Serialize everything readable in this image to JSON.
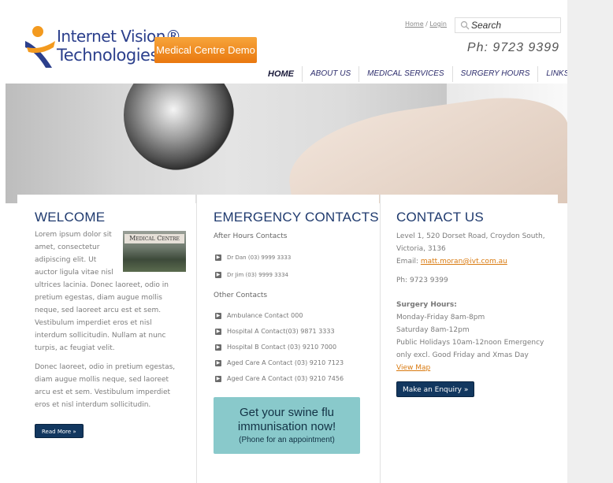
{
  "brand": {
    "logo_line1": "Internet Vision®",
    "logo_line2": "Technologies",
    "demo_badge": "Medical Centre Demo"
  },
  "toplinks": {
    "home": "Home",
    "separator": " / ",
    "login": "Login"
  },
  "search": {
    "placeholder": "Search",
    "value": "Search"
  },
  "phone": "Ph: 9723 9399",
  "nav": {
    "home": "HOME",
    "about": "ABOUT US",
    "services": "MEDICAL SERVICES",
    "hours": "SURGERY HOURS",
    "links": "LINKS"
  },
  "welcome": {
    "title": "WELCOME",
    "image_sign": "Medical Centre",
    "p1": "Lorem ipsum dolor sit amet, consectetur adipiscing elit. Ut auctor ligula vitae nisl ultrices lacinia. Donec laoreet, odio in pretium egestas, diam augue mollis neque, sed laoreet arcu est et sem. Vestibulum imperdiet eros et nisl interdum sollicitudin. Nullam at nunc turpis, ac feugiat velit.",
    "p2": "Donec laoreet, odio in pretium egestas, diam augue mollis neque, sed laoreet arcu est et sem. Vestibulum imperdiet eros et nisl interdum sollicitudin.",
    "read_more": "Read More »"
  },
  "emergency": {
    "title": "EMERGENCY CONTACTS",
    "after_hours_heading": "After Hours Contacts",
    "after_hours": [
      "Dr Dan (03) 9999 3333",
      "Dr Jim (03) 9999 3334"
    ],
    "other_heading": "Other Contacts",
    "other": [
      "Ambulance Contact 000",
      "Hospital A Contact(03) 9871 3333",
      "Hospital B Contact (03) 9210 7000",
      "Aged Care A Contact (03) 9210 7123",
      "Aged Care A Contact (03) 9210 7456"
    ],
    "swine_line1": "Get your swine flu",
    "swine_line2": "immunisation now!",
    "swine_line3": "(Phone for an appointment)"
  },
  "contact": {
    "title": "CONTACT US",
    "address": "Level 1, 520 Dorset Road, Croydon South, Victoria, 3136",
    "email_label": "Email: ",
    "email": "matt.moran@ivt.com.au",
    "phone": "Ph: 9723 9399",
    "hours_label": "Surgery Hours:",
    "hours_weekday": "Monday-Friday 8am-8pm",
    "hours_saturday": "Saturday 8am-12pm",
    "hours_holidays": "Public Holidays 10am-12noon Emergency only excl. Good Friday and Xmas Day",
    "view_map": "View Map",
    "enquiry_button": "Make an Enquiry »"
  },
  "colors": {
    "heading_blue": "#1f3a6e",
    "nav_blue": "#2c2c6c",
    "button_navy": "#12375f",
    "badge_orange": "#e9780f",
    "swine_teal": "#89c9cb",
    "link_orange": "#d97a10"
  }
}
